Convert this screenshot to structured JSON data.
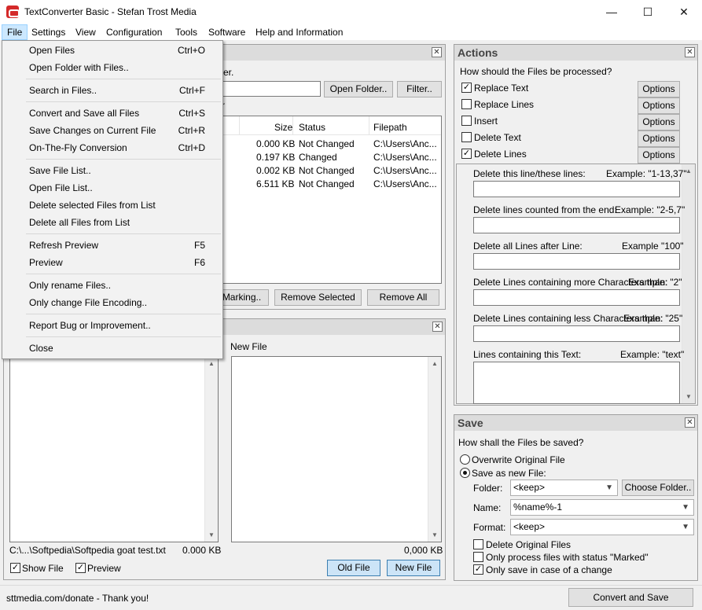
{
  "window": {
    "title": "TextConverter Basic - Stefan Trost Media",
    "min_symbol": "—",
    "max_symbol": "☐",
    "close_symbol": "✕"
  },
  "menubar": [
    "File",
    "Settings",
    "View",
    "Configuration",
    "Tools",
    "Software",
    "Help and Information"
  ],
  "file_menu": {
    "items": [
      {
        "label": "Open Files",
        "shortcut": "Ctrl+O"
      },
      {
        "label": "Open Folder with Files..",
        "shortcut": ""
      },
      {
        "label": "Search in Files..",
        "shortcut": "Ctrl+F"
      },
      {
        "label": "Convert and Save all Files",
        "shortcut": "Ctrl+S"
      },
      {
        "label": "Save Changes on Current File",
        "shortcut": "Ctrl+R"
      },
      {
        "label": "On-The-Fly Conversion",
        "shortcut": "Ctrl+D"
      },
      {
        "label": "Save File List..",
        "shortcut": ""
      },
      {
        "label": "Open File List..",
        "shortcut": ""
      },
      {
        "label": "Delete selected Files from List",
        "shortcut": ""
      },
      {
        "label": "Delete all Files from List",
        "shortcut": ""
      },
      {
        "label": "Refresh Preview",
        "shortcut": "F5"
      },
      {
        "label": "Preview",
        "shortcut": "F6"
      },
      {
        "label": "Only rename Files..",
        "shortcut": ""
      },
      {
        "label": "Only change File Encoding..",
        "shortcut": ""
      },
      {
        "label": "Report Bug or Improvement..",
        "shortcut": ""
      },
      {
        "label": "Close",
        "shortcut": ""
      }
    ]
  },
  "files_panel": {
    "hint_fragment": "er.",
    "open_folder_btn": "Open Folder..",
    "filter_btn": "Filter..",
    "col_fragment": "r",
    "columns": {
      "size": "Size",
      "status": "Status",
      "filepath": "Filepath"
    },
    "rows": [
      {
        "size": "0.000 KB",
        "status": "Not Changed",
        "path": "C:\\Users\\Anc..."
      },
      {
        "size": "0.197 KB",
        "status": "Changed",
        "path": "C:\\Users\\Anc..."
      },
      {
        "size": "0.002 KB",
        "status": "Not Changed",
        "path": "C:\\Users\\Anc..."
      },
      {
        "size": "6.511 KB",
        "status": "Not Changed",
        "path": "C:\\Users\\Anc..."
      }
    ],
    "marking_btn": "Marking..",
    "remove_selected_btn": "Remove Selected",
    "remove_all_btn": "Remove All"
  },
  "preview_panel": {
    "new_file_label": "New File",
    "old_path": "C:\\...\\Softpedia\\Softpedia goat test.txt",
    "old_size": "0.000 KB",
    "new_size": "0,000 KB",
    "show_file": "Show File",
    "preview": "Preview",
    "old_file_btn": "Old File",
    "new_file_btn": "New File"
  },
  "actions": {
    "title": "Actions",
    "question": "How should the Files be processed?",
    "options_btn": "Options",
    "items": [
      {
        "label": "Replace Text",
        "checked": true
      },
      {
        "label": "Replace Lines",
        "checked": false
      },
      {
        "label": "Insert",
        "checked": false
      },
      {
        "label": "Delete Text",
        "checked": false
      },
      {
        "label": "Delete Lines",
        "checked": true
      }
    ],
    "fields": [
      {
        "label": "Delete this line/these lines:",
        "example": "Example: \"1-13,37\""
      },
      {
        "label": "Delete lines counted from the end:",
        "example": "Example: \"2-5,7\""
      },
      {
        "label": "Delete all Lines after Line:",
        "example": "Example \"100\""
      },
      {
        "label": "Delete Lines containing more Characters than:",
        "example": "Example: \"2\""
      },
      {
        "label": "Delete Lines containing less Characters than:",
        "example": "Example: \"25\""
      },
      {
        "label": "Lines containing this Text:",
        "example": "Example: \"text\""
      }
    ]
  },
  "save": {
    "title": "Save",
    "question": "How shall the Files be saved?",
    "overwrite": "Overwrite Original File",
    "save_as_new": "Save as new File:",
    "folder_label": "Folder:",
    "folder_value": "<keep>",
    "choose_folder_btn": "Choose Folder..",
    "name_label": "Name:",
    "name_value": "%name%-1",
    "format_label": "Format:",
    "format_value": "<keep>",
    "delete_original": "Delete Original Files",
    "only_marked": "Only process files with status \"Marked\"",
    "only_changed": "Only save in case of a change"
  },
  "statusbar": {
    "donate": "sttmedia.com/donate - Thank you!",
    "convert_btn": "Convert and Save"
  }
}
